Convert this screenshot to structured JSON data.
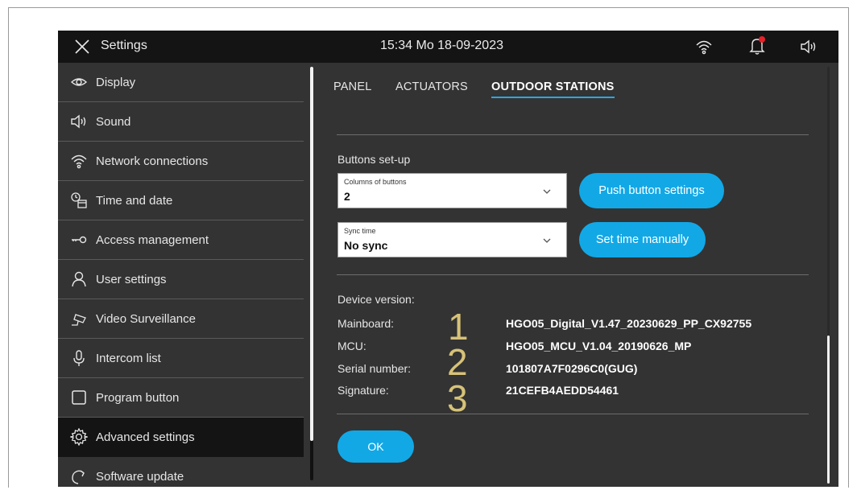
{
  "header": {
    "title": "Settings",
    "clock": "15:34  Mo 18-09-2023",
    "colors": {
      "bar": "#141414",
      "notification_dot": "#e8202a"
    }
  },
  "sidebar": {
    "items": [
      {
        "label": "Display",
        "icon": "eye-icon"
      },
      {
        "label": "Sound",
        "icon": "speaker-icon"
      },
      {
        "label": "Network connections",
        "icon": "wifi-icon"
      },
      {
        "label": "Time and date",
        "icon": "clock-calendar-icon"
      },
      {
        "label": "Access  management",
        "icon": "key-icon"
      },
      {
        "label": "User settings",
        "icon": "user-icon"
      },
      {
        "label": "Video Surveillance",
        "icon": "camera-icon"
      },
      {
        "label": "Intercom list",
        "icon": "microphone-icon"
      },
      {
        "label": "Program button",
        "icon": "square-icon"
      },
      {
        "label": "Advanced settings",
        "icon": "gear-icon",
        "active": true
      },
      {
        "label": "Software update",
        "icon": "refresh-icon"
      }
    ]
  },
  "tabs": [
    {
      "label": "PANEL"
    },
    {
      "label": "ACTUATORS"
    },
    {
      "label": "OUTDOOR STATIONS",
      "active": true
    }
  ],
  "buttons_setup": {
    "label": "Buttons set-up",
    "columns_select": {
      "label": "Columns of buttons",
      "value": "2"
    },
    "push_button": "Push button settings",
    "sync_select": {
      "label": "Sync time",
      "value": "No sync"
    },
    "set_time_button": "Set time manually"
  },
  "device_version": {
    "label": "Device version:",
    "rows": [
      {
        "label": "Mainboard:",
        "value": "HGO05_Digital_V1.47_20230629_PP_CX92755"
      },
      {
        "label": "MCU:",
        "value": "HGO05_MCU_V1.04_20190626_MP"
      },
      {
        "label": "Serial number:",
        "value": "101807A7F0296C0(GUG)"
      },
      {
        "label": "Signature:",
        "value": "21CEFB4AEDD54461"
      }
    ],
    "annotations": [
      "1",
      "2",
      "3"
    ]
  },
  "ok_button": "OK",
  "accent_color": "#12a8e6"
}
